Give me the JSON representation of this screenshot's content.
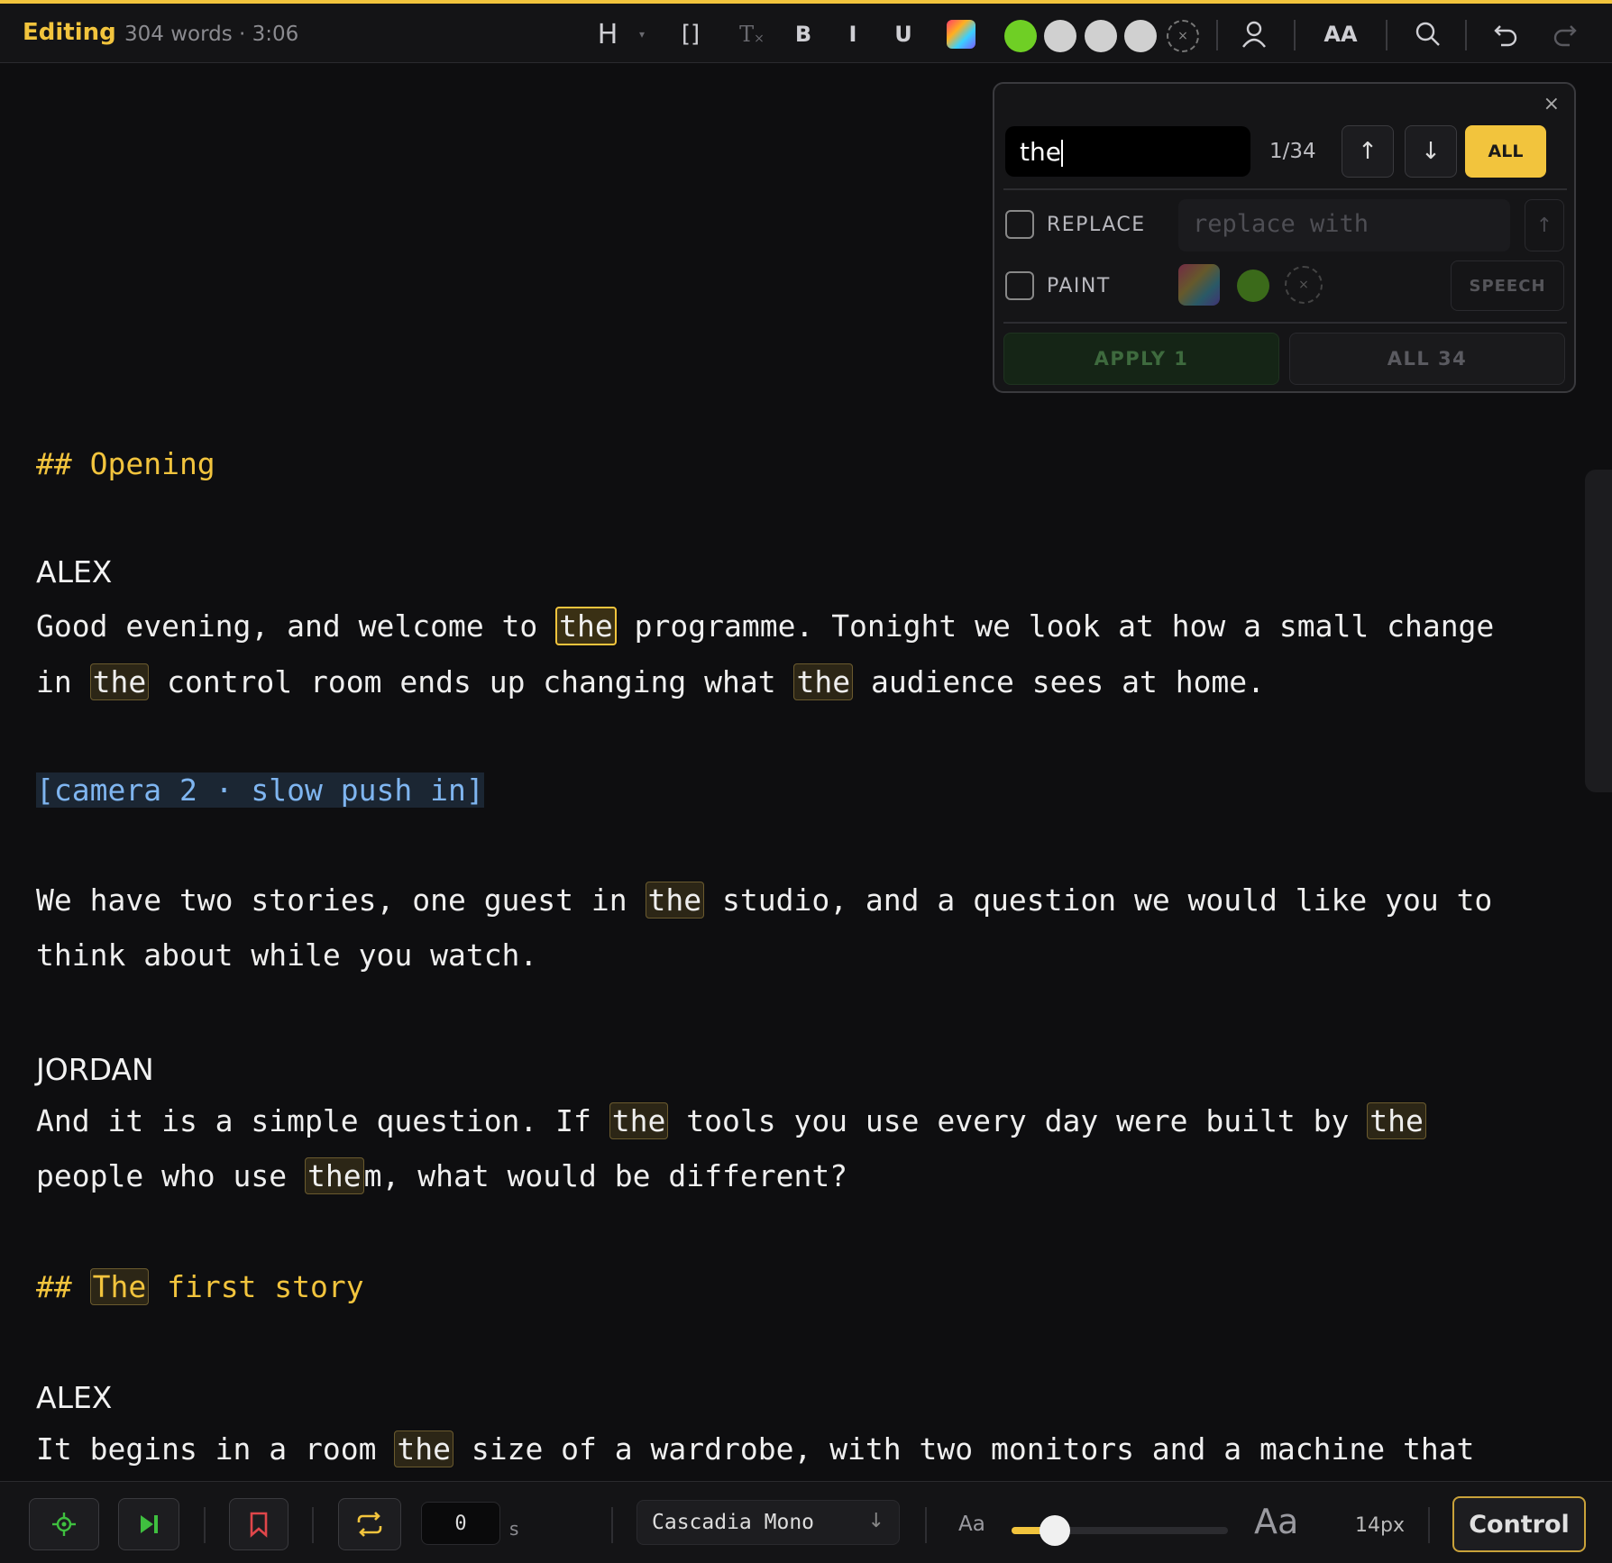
{
  "topbar": {
    "mode": "Editing",
    "stats": "304 words · 3:06",
    "heading_btn": "H",
    "bracket_btn": "[]",
    "clear_format_btn": "T",
    "bold_btn": "B",
    "italic_btn": "I",
    "underline_btn": "U",
    "case_btn": "AA",
    "color_dots": [
      "#6fcf25",
      "#d0d0d0",
      "#d0d0d0",
      "#d0d0d0"
    ]
  },
  "find": {
    "query": "the",
    "count": "1/34",
    "prev_label": "↑",
    "next_label": "↓",
    "all_label": "ALL",
    "replace_label": "REPLACE",
    "replace_placeholder": "replace with",
    "paint_label": "PAINT",
    "speech_label": "SPEECH",
    "apply_one_label": "APPLY 1",
    "apply_all_label": "ALL 34",
    "close_label": "×"
  },
  "script": {
    "heading_opening": "## Opening",
    "speaker_alex_1": "ALEX",
    "alex_1_l1": [
      "Good evening, and welcome to ",
      "the",
      " programme. Tonight we look at how a small change"
    ],
    "alex_1_l2": [
      "in ",
      "the",
      " control room ends up changing what ",
      "the",
      " audience sees at home."
    ],
    "cue_1": "[camera 2 · slow push in]",
    "para_2_l1": [
      "We have two stories, one guest in ",
      "the",
      " studio, and a question we would like you to"
    ],
    "para_2_l2": "think about while you watch.",
    "speaker_jordan": "JORDAN",
    "jordan_l1": [
      "And it is a simple question. If ",
      "the",
      " tools you use every day were built by ",
      "the"
    ],
    "jordan_l2": [
      "people who use ",
      "the",
      "m, what would be different?"
    ],
    "heading_first_prefix": "## ",
    "heading_first_match": "The",
    "heading_first_rest": " first story",
    "speaker_alex_2": "ALEX",
    "alex_2_l1": [
      "It begins in a room ",
      "the",
      " size of a wardrobe, with two monitors and a machine that"
    ]
  },
  "bottombar": {
    "offset_value": "0",
    "offset_unit": "s",
    "font_name": "Cascadia Mono",
    "font_arrow": "↓",
    "aa_small": "Aa",
    "aa_big": "Aa",
    "size_label": "14px",
    "font_size_level": 0.2,
    "control_label": "Control"
  },
  "colors": {
    "accent": "#f2c43d",
    "heading": "#f2c43d",
    "cue": "#7fb5f0",
    "green_action": "#3fbf3f",
    "bookmark_red": "#e0464a"
  }
}
